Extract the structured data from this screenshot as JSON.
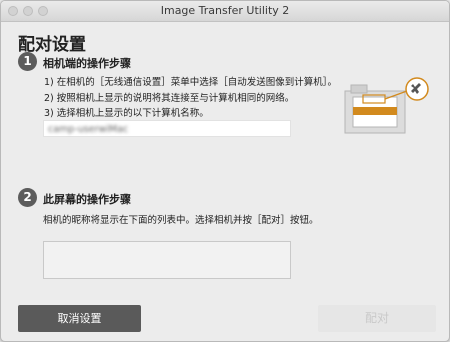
{
  "window": {
    "title": "Image Transfer Utility 2"
  },
  "heading": "配对设置",
  "step1": {
    "number": "1",
    "title": "相机端的操作步骤",
    "instructions": [
      "1)  在相机的［无线通信设置］菜单中选择［自动发送图像到计算机］。",
      "2)  按照相机上显示的说明将其连接至与计算机相同的网络。",
      "3)  选择相机上显示的以下计算机名称。"
    ],
    "computer_name": "camp-userwiMac"
  },
  "step2": {
    "number": "2",
    "title": "此屏幕的操作步骤",
    "description": "相机的昵称将显示在下面的列表中。选择相机并按［配对］按钮。"
  },
  "buttons": {
    "cancel": "取消设置",
    "pair": "配对"
  },
  "icons": {
    "window_controls": [
      "close-dot",
      "minimize-dot",
      "zoom-dot"
    ],
    "illustration": "camera-with-wireless-icon",
    "badge": "wrench-icon"
  },
  "colors": {
    "accent_orange": "#d28a1e",
    "button_dark": "#5a5a5a",
    "button_disabled": "#e6e6e6"
  }
}
